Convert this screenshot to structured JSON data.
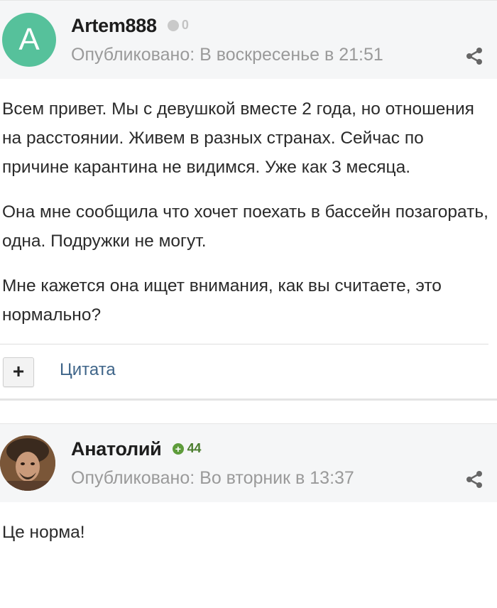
{
  "posts": [
    {
      "author": "Artem888",
      "avatar_letter": "A",
      "avatar_color": "#56c19b",
      "reputation": "0",
      "published": "Опубликовано: В воскресенье в 21:51",
      "paragraphs": [
        "Всем привет. Мы с девушкой вместе 2 года, но отношения на расстоянии. Живем в разных странах. Сейчас по причине карантина не видимся. Уже как 3 месяца.",
        "Она мне сообщила что хочет поехать в бассейн позагорать, одна. Подружки не могут.",
        "Мне кажется она ищет внимания, как вы считаете, это нормально?"
      ],
      "plus_label": "+",
      "quote_label": "Цитата"
    },
    {
      "author": "Анатолий",
      "reputation": "44",
      "published": "Опубликовано: Во вторник в 13:37",
      "paragraphs": [
        "Це норма!"
      ]
    }
  ],
  "colors": {
    "header_bg": "#f5f6f7",
    "reputation_positive": "#5e9c3b",
    "link": "#3f6589"
  }
}
